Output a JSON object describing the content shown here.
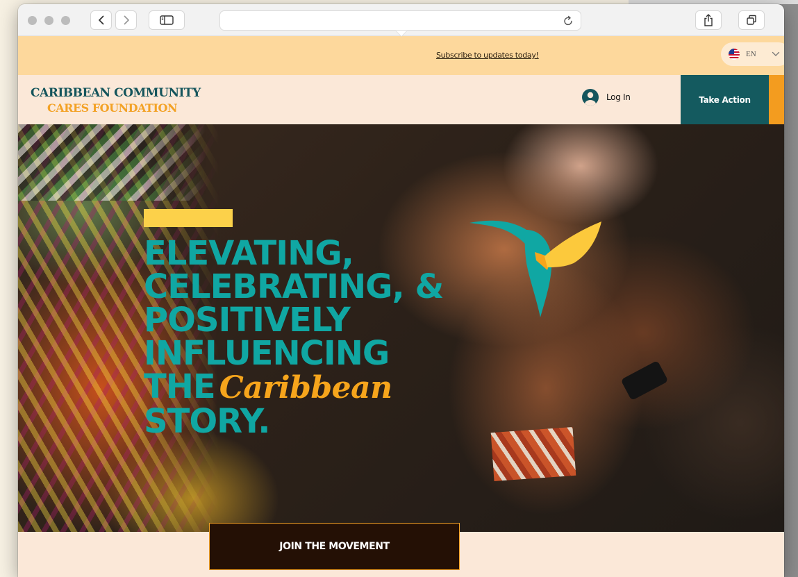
{
  "banner": {
    "subscribe_link": "Subscribe to updates today!"
  },
  "language": {
    "code": "EN"
  },
  "header": {
    "logo_line1": "CARIBBEAN COMMUNITY",
    "logo_line2": "CARES FOUNDATION",
    "login_label": "Log In",
    "take_action_label": "Take Action"
  },
  "hero": {
    "line1": "ELEVATING,",
    "line2": "CELEBRATING, &",
    "line3": "POSITIVELY",
    "line4": "INFLUENCING",
    "line5_prefix": "THE",
    "line5_script": "Caribbean",
    "line6": "STORY."
  },
  "cta": {
    "label": "JOIN THE MOVEMENT"
  },
  "colors": {
    "teal": "#10a7a3",
    "dark_teal": "#145a5f",
    "orange": "#f39c1f",
    "banner": "#fdd89c",
    "header_bg": "#fbe8d8",
    "cta_bg": "#241005"
  }
}
